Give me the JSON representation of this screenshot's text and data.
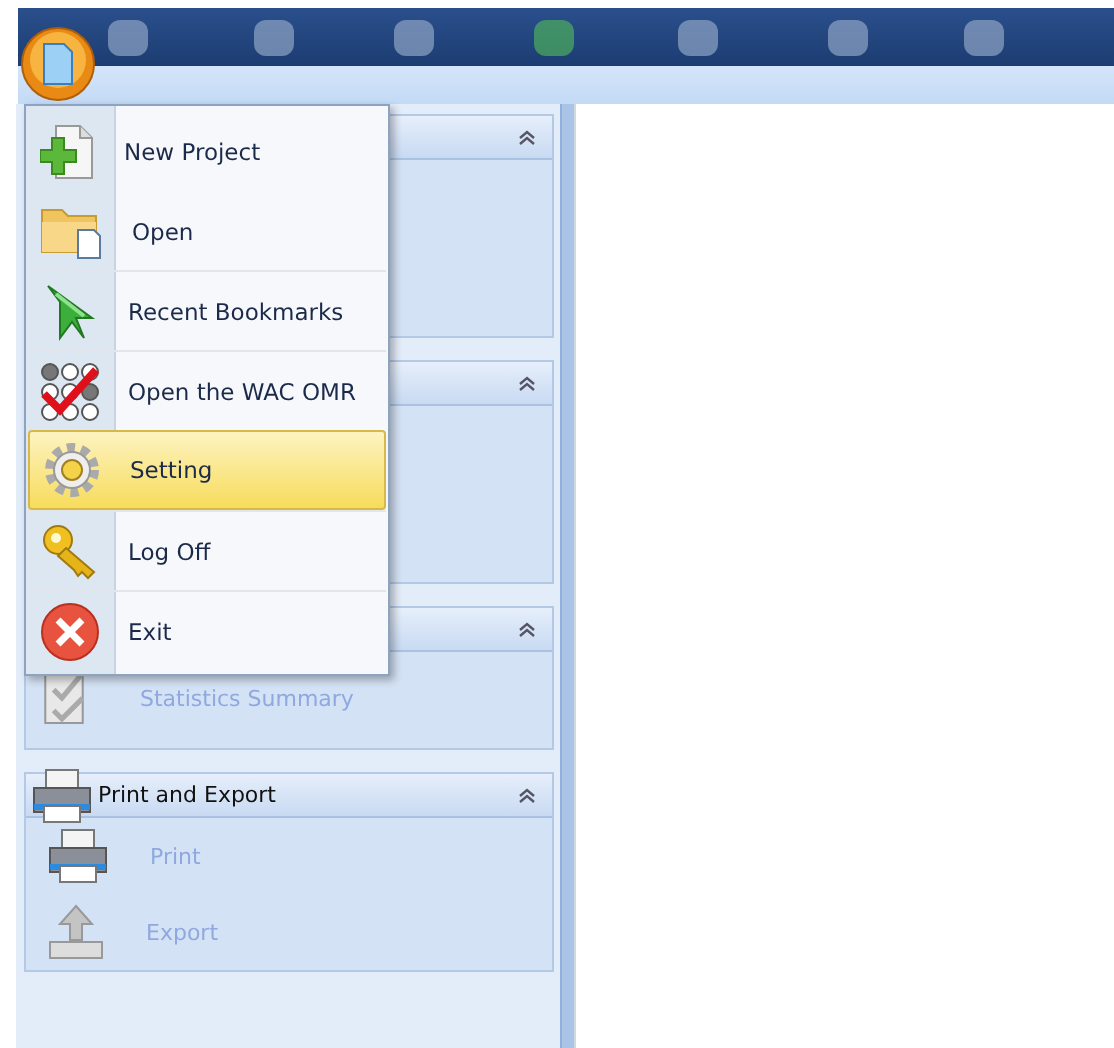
{
  "app_menu": {
    "items": [
      {
        "label": "New Project",
        "selected": false
      },
      {
        "label": "Open",
        "selected": false
      },
      {
        "label": "Recent Bookmarks",
        "selected": false
      },
      {
        "label": "Open the WAC OMR",
        "selected": false
      },
      {
        "label": "Setting",
        "selected": true
      },
      {
        "label": "Log Off",
        "selected": false
      },
      {
        "label": "Exit",
        "selected": false
      }
    ]
  },
  "sidebar": {
    "groups": [
      {
        "expanded": true
      },
      {
        "expanded": true
      },
      {
        "expanded": true,
        "items": [
          {
            "label": "Statistics Summary"
          }
        ]
      },
      {
        "title": "Print and Export",
        "expanded": true,
        "items": [
          {
            "label": "Print"
          },
          {
            "label": "Export"
          }
        ]
      }
    ]
  }
}
